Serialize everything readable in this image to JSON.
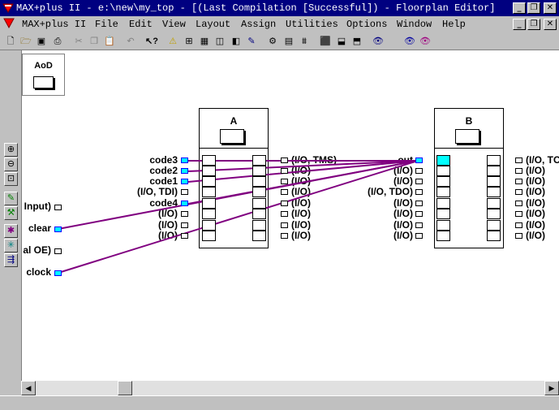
{
  "window": {
    "title": "MAX+plus II - e:\\new\\my_top - [(Last Compilation [Successful]) - Floorplan Editor]"
  },
  "menu": [
    "MAX+plus II",
    "File",
    "Edit",
    "View",
    "Layout",
    "Assign",
    "Utilities",
    "Options",
    "Window",
    "Help"
  ],
  "aod": {
    "label": "AoD"
  },
  "lab_a": {
    "name": "A",
    "left_labels": [
      "code3",
      "code2",
      "code1",
      "(I/O, TDI)",
      "code4",
      "(I/O)",
      "(I/O)",
      "(I/O)"
    ],
    "right_labels": [
      "(I/O, TMS)",
      "(I/O)",
      "(I/O)",
      "(I/O)",
      "(I/O)",
      "(I/O)",
      "(I/O)",
      "(I/O)"
    ]
  },
  "lab_b": {
    "name": "B",
    "left_labels": [
      "out",
      "(I/O)",
      "(I/O)",
      "(I/O, TDO)",
      "(I/O)",
      "(I/O)",
      "(I/O)",
      "(I/O)"
    ],
    "right_labels": [
      "(I/O, TC",
      "(I/O)",
      "(I/O)",
      "(I/O)",
      "(I/O)",
      "(I/O)",
      "(I/O)",
      "(I/O)"
    ]
  },
  "side_pins": [
    "Input)",
    "clear",
    "al OE)",
    "clock"
  ],
  "colors": {
    "wire": "#800080",
    "highlight": "#00ffff",
    "titlebar": "#000080"
  }
}
